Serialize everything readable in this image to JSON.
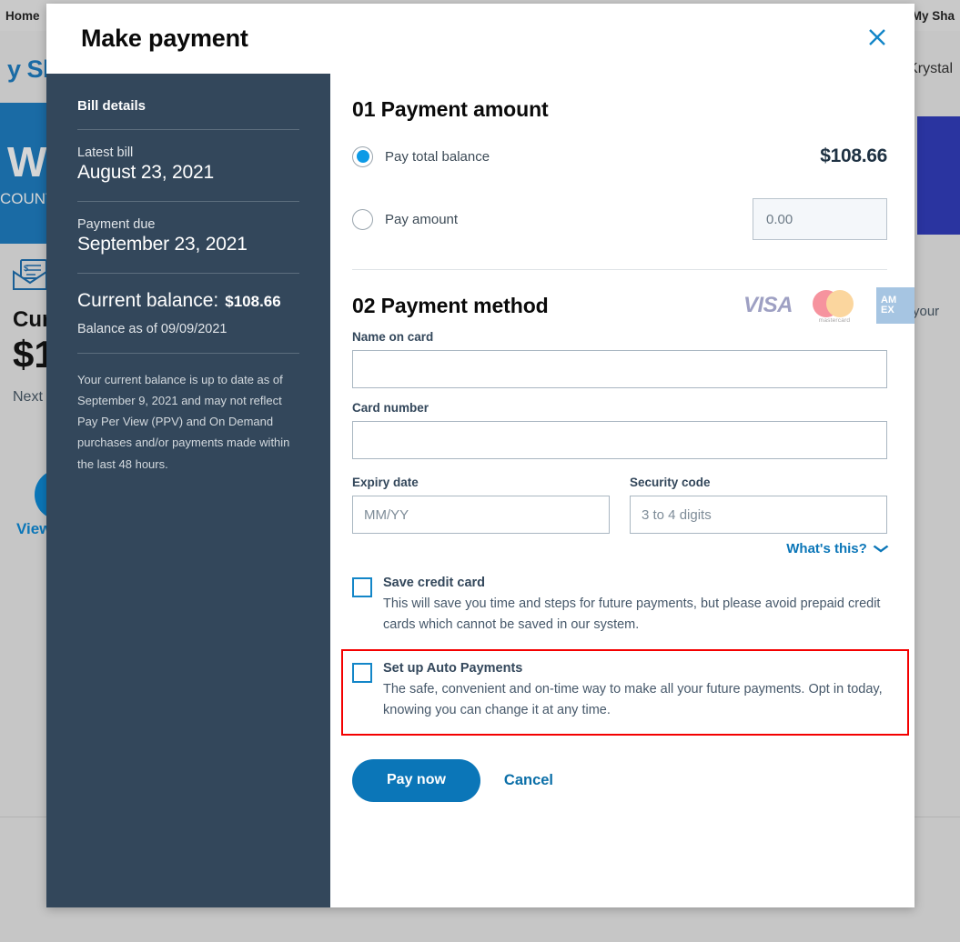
{
  "background": {
    "nav_home": "Home",
    "nav_my_shaw": "My Sha",
    "brand": "y Sha",
    "user_name": "Krystal",
    "banner_line1": "WEL",
    "banner_line2": "COUNT",
    "card_title": "Cur",
    "card_amount": "$1",
    "card_next": "Next",
    "card_link": "View",
    "right_text": "your"
  },
  "modal": {
    "title": "Make payment",
    "close_icon": "close-icon"
  },
  "sidebar": {
    "title": "Bill details",
    "rows": [
      {
        "label": "Latest bill",
        "value": "August 23, 2021"
      },
      {
        "label": "Payment due",
        "value": "September 23, 2021"
      }
    ],
    "balance_label": "Current balance:",
    "balance_amount": "$108.66",
    "balance_as_of": "Balance as of 09/09/2021",
    "note": "Your current balance is up to date as of September 9, 2021 and may not reflect Pay Per View (PPV) and On Demand purchases and/or payments made within the last 48 hours."
  },
  "payment_amount": {
    "section_title": "01 Payment amount",
    "option_total_label": "Pay total balance",
    "option_total_selected": true,
    "total_amount": "$108.66",
    "option_custom_label": "Pay amount",
    "option_custom_selected": false,
    "custom_amount_value": "",
    "custom_amount_placeholder": "0.00"
  },
  "payment_method": {
    "section_title": "02 Payment method",
    "accepted_cards": [
      {
        "name": "visa-logo",
        "label": "VISA"
      },
      {
        "name": "mastercard-logo",
        "label": "mastercard"
      },
      {
        "name": "amex-logo",
        "label_line1": "AM",
        "label_line2": "EX"
      }
    ],
    "fields": {
      "name_on_card": {
        "label": "Name on card",
        "value": "",
        "placeholder": ""
      },
      "card_number": {
        "label": "Card number",
        "value": "",
        "placeholder": ""
      },
      "expiry_date": {
        "label": "Expiry date",
        "value": "",
        "placeholder": "MM/YY"
      },
      "security_code": {
        "label": "Security code",
        "value": "",
        "placeholder": "3 to 4 digits"
      }
    },
    "whats_this": "What's this?",
    "whats_this_chevron": "⌄"
  },
  "options": [
    {
      "title": "Save credit card",
      "description": "This will save you time and steps for future payments, but please avoid prepaid credit cards which cannot be saved in our system.",
      "checked": false,
      "highlighted": false
    },
    {
      "title": "Set up Auto Payments",
      "description": "The safe, convenient and on-time way to make all your future payments. Opt in today, knowing you can change it at any time.",
      "checked": false,
      "highlighted": true
    }
  ],
  "actions": {
    "pay_now": "Pay now",
    "cancel": "Cancel"
  },
  "colors": {
    "accent_blue": "#0b76b8",
    "radio_blue": "#0d9ae6",
    "sidebar_navy": "#33475b",
    "highlight_red": "#f40000",
    "backdrop_gray": "#c6c6c6",
    "banner_blue": "#1a6ba5",
    "right_banner_indigo": "#2a34a0"
  }
}
